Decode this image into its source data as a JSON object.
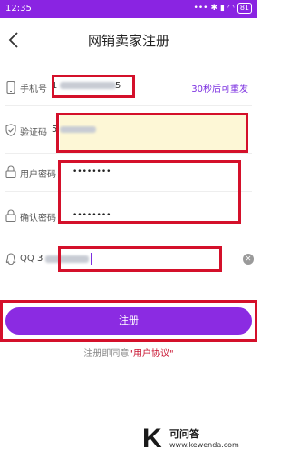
{
  "status_bar": {
    "time": "12:35",
    "icons": [
      "dots-icon",
      "bluetooth-icon",
      "signal-icon",
      "wifi-icon"
    ],
    "battery": "81"
  },
  "header": {
    "title": "网销卖家注册",
    "back_icon": "back-chevron-icon"
  },
  "form": {
    "phone": {
      "label": "手机号",
      "value": "1",
      "value_tail": "5",
      "resend_label": "30秒后可重发"
    },
    "code": {
      "label": "验证码",
      "value": "5"
    },
    "password": {
      "label": "用户密码",
      "value": "••••••••"
    },
    "confirm": {
      "label": "确认密码",
      "value": "••••••••"
    },
    "qq": {
      "label": "QQ",
      "value": "3"
    }
  },
  "register_button": {
    "label": "注册"
  },
  "agreement": {
    "prefix": "注册即同意",
    "link": "\"用户协议\""
  },
  "watermark": {
    "mark": "K",
    "title": "可问答",
    "url": "www.kewenda.com"
  },
  "colors": {
    "accent": "#8b2be2",
    "highlight": "#d4102a",
    "code_field_bg": "#fdf7d6"
  }
}
